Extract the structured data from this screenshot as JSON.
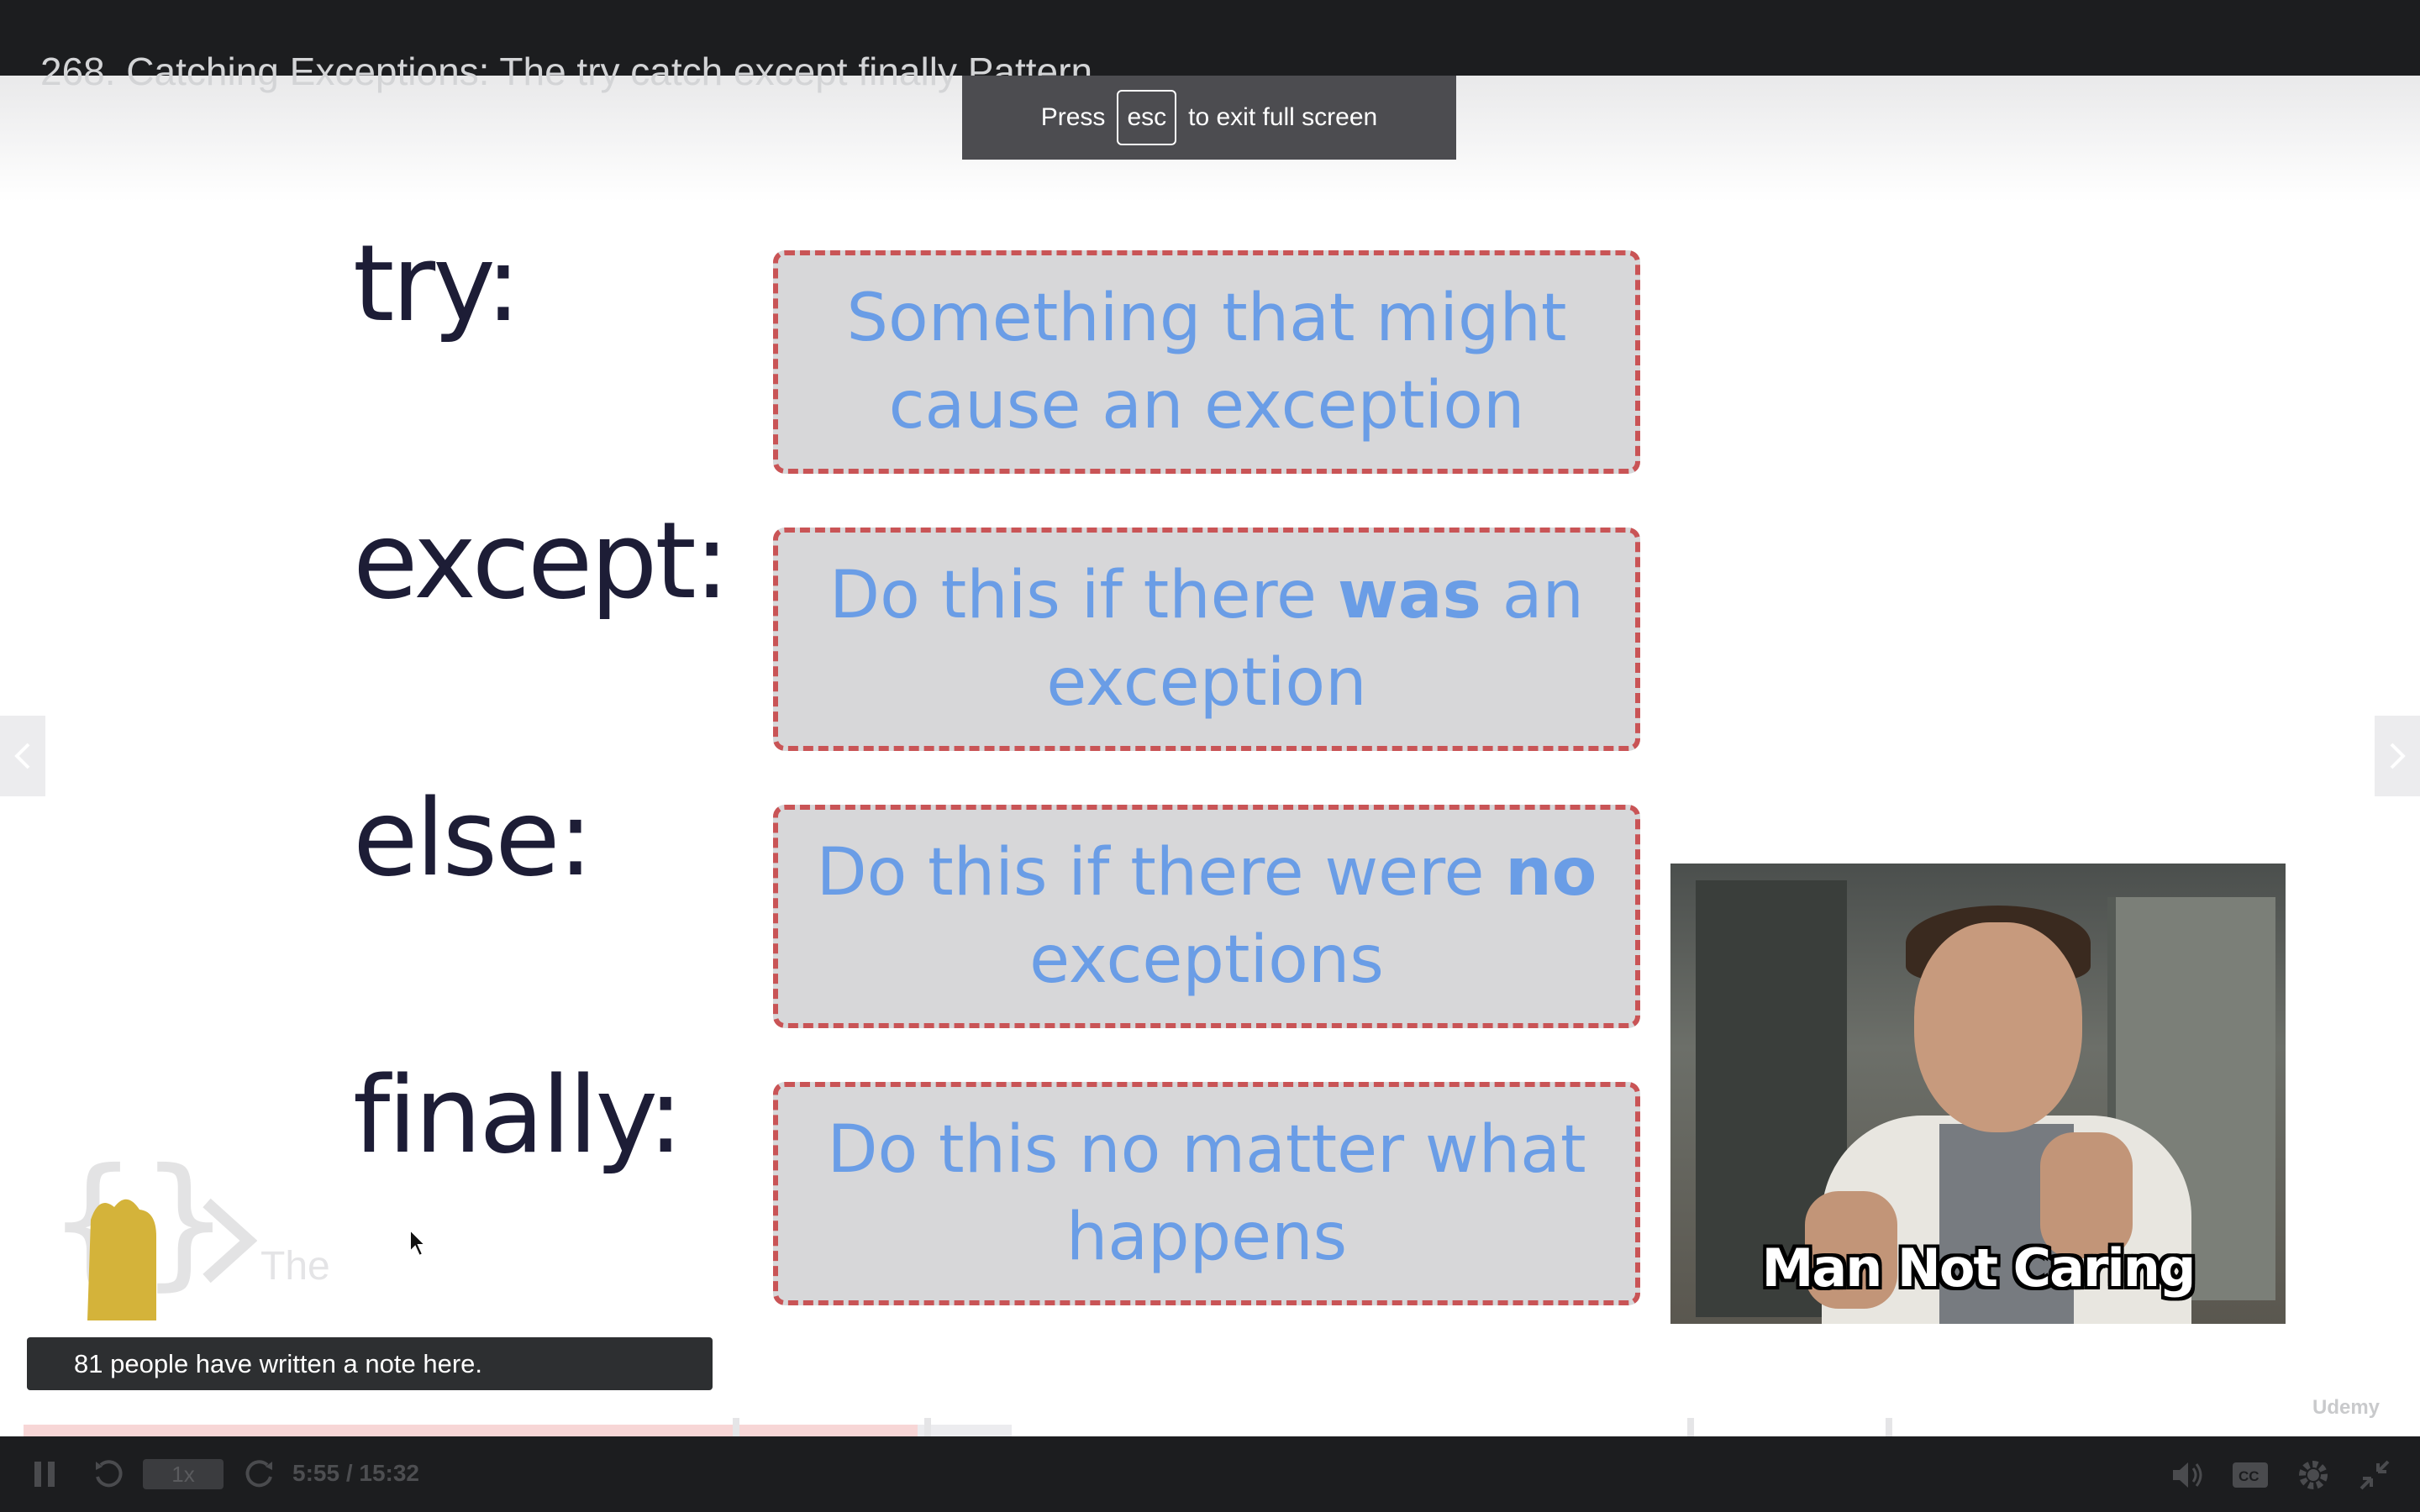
{
  "lecture": {
    "title": "268. Catching Exceptions: The try catch except finally Pattern"
  },
  "fullscreen_toast": {
    "prefix": "Press",
    "key": "esc",
    "suffix": "to exit full screen"
  },
  "slide": {
    "rows": [
      {
        "keyword": "try:",
        "text_before": "Something that might cause an exception",
        "bold": "",
        "text_after": ""
      },
      {
        "keyword": "except:",
        "text_before": "Do this if there ",
        "bold": "was",
        "text_after": " an exception"
      },
      {
        "keyword": "else:",
        "text_before": "Do this if there were ",
        "bold": "no",
        "text_after": " exceptions"
      },
      {
        "keyword": "finally:",
        "text_before": "Do this no matter what happens",
        "bold": "",
        "text_after": ""
      }
    ],
    "meme_caption": "Man Not Caring",
    "logo_text": "The"
  },
  "notes_banner": {
    "text": "81 people have written a note here."
  },
  "player": {
    "speed": "1x",
    "time": "5:55 / 15:32",
    "progress_fraction": 0.38,
    "brand": "Udemy",
    "icons": [
      "pause-icon",
      "rewind-icon",
      "forward-icon",
      "volume-icon",
      "captions-icon",
      "settings-icon",
      "exit-fullscreen-icon"
    ]
  }
}
